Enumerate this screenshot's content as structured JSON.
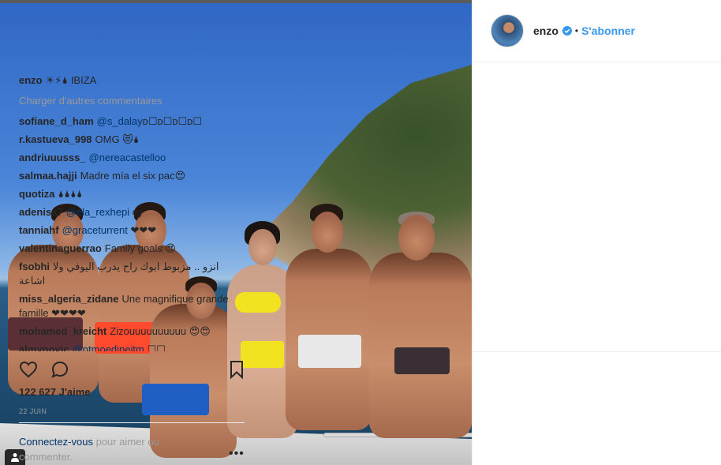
{
  "post": {
    "user_icon": "user-tag-icon"
  },
  "header": {
    "username": "enzo",
    "dot": "•",
    "follow_label": "S'abonner",
    "verified_color": "#3897f0"
  },
  "caption": {
    "username": "enzo",
    "text": "☀⚡🌢 IBIZA"
  },
  "load_more_label": "Charger d'autres commentaires",
  "comments": [
    {
      "user": "sofiane_d_ham",
      "mention": "@s_dalay",
      "text": "ᴅ☐ᴅ☐ᴅ☐ᴅ☐"
    },
    {
      "user": "r.kastueva_998",
      "mention": "",
      "text": "OMG 😻🌢"
    },
    {
      "user": "andriuuusss_",
      "mention": "@nereacastelloo",
      "text": ""
    },
    {
      "user": "salmaa.hajji",
      "mention": "",
      "text": "Madre mía el six pac😍"
    },
    {
      "user": "quotiza",
      "mention": "",
      "text": "🌢🌢🌢🌢"
    },
    {
      "user": "adenisa7",
      "mention": "@ela_rexhepi",
      "text": "ey"
    },
    {
      "user": "tanniahf",
      "mention": "@graceturrent",
      "text": "❤❤❤"
    },
    {
      "user": "valentinaguerrao",
      "mention": "",
      "text": "Family goals 😍"
    },
    {
      "user": "fsobhi",
      "mention": "",
      "text": "انزو .. مزبوط ابوك راح يدرب اليوفي ولا اشاعة"
    },
    {
      "user": "miss_algeria_zidane",
      "mention": "",
      "text": "Une magnifique grande famille ❤❤❤❤"
    },
    {
      "user": "mohamed_kreicht",
      "mention": "",
      "text": "Zizouuuuuuuuuu 😍😍"
    },
    {
      "user": "almynovic",
      "mention": "@ntmoedipejtm",
      "text": "☐☐"
    }
  ],
  "likes": "122 627 J'aime",
  "date": "22 JUIN",
  "login": {
    "link": "Connectez-vous",
    "rest": " pour aimer ou commenter."
  },
  "more_label": "•••",
  "icons": {
    "like": "heart-icon",
    "comment": "comment-bubble-icon",
    "save": "bookmark-icon"
  }
}
